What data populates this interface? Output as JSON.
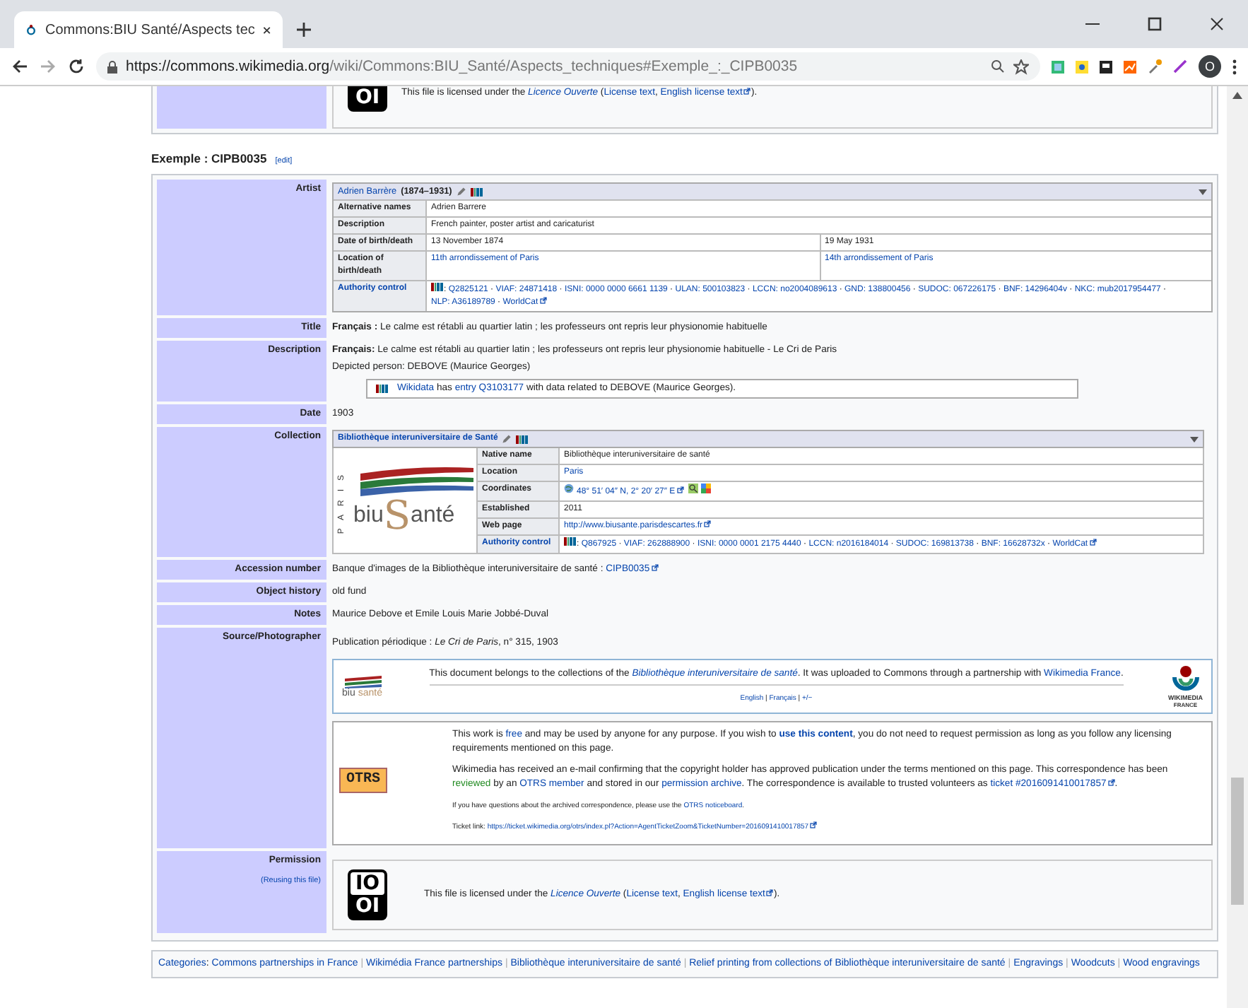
{
  "browser": {
    "tab_title": "Commons:BIU Santé/Aspects tec",
    "url_host": "https://commons.wikimedia.org",
    "url_path": "/wiki/Commons:BIU_Santé/Aspects_techniques#Exemple_:_CIPB0035",
    "profile_initial": "O"
  },
  "previous_permission": {
    "logo": "OI",
    "text": [
      {
        "kind": "plain",
        "text": "This file is licensed under the "
      },
      {
        "kind": "italic-link",
        "text": "Licence Ouverte"
      },
      {
        "kind": "plain",
        "text": " ("
      },
      {
        "kind": "link",
        "text": "License text"
      },
      {
        "kind": "plain",
        "text": ", "
      },
      {
        "kind": "external",
        "text": "English license text"
      },
      {
        "kind": "plain",
        "text": ")."
      }
    ]
  },
  "section": {
    "title": "Exemple : CIPB0035",
    "edit": "[edit]"
  },
  "fields": [
    {
      "kind": "creator",
      "label": "Artist",
      "name": "Adrien Barrère",
      "dates": "(1874–1931)",
      "rows": [
        {
          "kind": "plain",
          "label": "Alternative names",
          "cells": [
            [
              {
                "kind": "plain",
                "text": "Adrien Barrere"
              }
            ]
          ]
        },
        {
          "kind": "plain",
          "label": "Description",
          "cells": [
            [
              {
                "kind": "plain",
                "text": "French painter, poster artist and caricaturist"
              }
            ]
          ]
        },
        {
          "kind": "plain",
          "label": "Date of birth/death",
          "cells": [
            [
              {
                "kind": "plain",
                "text": "13 November 1874"
              }
            ],
            [
              {
                "kind": "plain",
                "text": "19 May 1931"
              }
            ]
          ]
        },
        {
          "kind": "plain",
          "label": "Location of birth/death",
          "cells": [
            [
              {
                "kind": "link",
                "text": "11th arrondissement of Paris"
              }
            ],
            [
              {
                "kind": "link",
                "text": "14th arrondissement of Paris"
              }
            ]
          ]
        },
        {
          "kind": "authority",
          "label": "Authority control",
          "cells": [
            [
              {
                "kind": "plain",
                "text": ": "
              },
              {
                "kind": "link",
                "text": "Q2825121"
              },
              {
                "kind": "plain",
                "text": " · "
              },
              {
                "kind": "link",
                "text": "VIAF: 24871418"
              },
              {
                "kind": "plain",
                "text": " · "
              },
              {
                "kind": "link",
                "text": "ISNI: 0000 0000 6661 1139"
              },
              {
                "kind": "plain",
                "text": " · "
              },
              {
                "kind": "link",
                "text": "ULAN: 500103823"
              },
              {
                "kind": "plain",
                "text": " · "
              },
              {
                "kind": "link",
                "text": "LCCN: no2004089613"
              },
              {
                "kind": "plain",
                "text": " · "
              },
              {
                "kind": "link",
                "text": "GND: 138800456"
              },
              {
                "kind": "plain",
                "text": " · "
              },
              {
                "kind": "link",
                "text": "SUDOC: 067226175"
              },
              {
                "kind": "plain",
                "text": " · "
              },
              {
                "kind": "link",
                "text": "BNF: 14296404v"
              },
              {
                "kind": "plain",
                "text": " · "
              },
              {
                "kind": "link",
                "text": "NKC: mub2017954477"
              },
              {
                "kind": "plain",
                "text": " · "
              },
              {
                "kind": "link",
                "text": "NLP: A36189789"
              },
              {
                "kind": "plain",
                "text": " · "
              },
              {
                "kind": "external",
                "text": "WorldCat"
              }
            ]
          ]
        }
      ]
    },
    {
      "kind": "text",
      "label": "Title",
      "paragraphs": [
        [
          {
            "kind": "bold",
            "text": "Français :"
          },
          {
            "kind": "plain",
            "text": " Le calme est rétabli au quartier latin ; les professeurs ont repris leur physionomie habituelle"
          }
        ]
      ]
    },
    {
      "kind": "text",
      "label": "Description",
      "paragraphs": [
        [
          {
            "kind": "bold",
            "text": "Français:"
          },
          {
            "kind": "plain",
            "text": " Le calme est rétabli au quartier latin ; les professeurs ont repris leur physionomie habituelle - Le Cri de Paris"
          }
        ],
        [
          {
            "kind": "plain",
            "text": "Depicted person: DEBOVE (Maurice Georges)"
          }
        ]
      ],
      "wikidata_note": [
        {
          "kind": "link",
          "text": "Wikidata"
        },
        {
          "kind": "plain",
          "text": " has "
        },
        {
          "kind": "link",
          "text": "entry Q3103177"
        },
        {
          "kind": "plain",
          "text": " with data related to DEBOVE (Maurice Georges)."
        }
      ]
    },
    {
      "kind": "text",
      "label": "Date",
      "paragraphs": [
        [
          {
            "kind": "plain",
            "text": "1903"
          }
        ]
      ]
    },
    {
      "kind": "institution",
      "label": "Collection",
      "name": "Bibliothèque interuniversitaire de Santé",
      "logo": {
        "side": "PARIS",
        "left": "biu",
        "letter": "S",
        "right": "anté"
      },
      "rows": [
        {
          "kind": "plain",
          "label": "Native name",
          "cells": [
            [
              {
                "kind": "plain",
                "text": "Bibliothèque interuniversitaire de santé"
              }
            ]
          ]
        },
        {
          "kind": "plain",
          "label": "Location",
          "cells": [
            [
              {
                "kind": "link",
                "text": "Paris"
              }
            ]
          ]
        },
        {
          "kind": "coordinates",
          "label": "Coordinates",
          "cells": [
            [
              {
                "kind": "external",
                "text": "48° 51′ 04″ N, 2° 20′ 27″ E"
              }
            ]
          ]
        },
        {
          "kind": "plain",
          "label": "Established",
          "cells": [
            [
              {
                "kind": "plain",
                "text": "2011"
              }
            ]
          ]
        },
        {
          "kind": "plain",
          "label": "Web page",
          "cells": [
            [
              {
                "kind": "external",
                "text": "http://www.biusante.parisdescartes.fr"
              }
            ]
          ]
        },
        {
          "kind": "authority",
          "label": "Authority control",
          "cells": [
            [
              {
                "kind": "plain",
                "text": ": "
              },
              {
                "kind": "link",
                "text": "Q867925"
              },
              {
                "kind": "plain",
                "text": " · "
              },
              {
                "kind": "link",
                "text": "VIAF: 262888900"
              },
              {
                "kind": "plain",
                "text": " · "
              },
              {
                "kind": "link",
                "text": "ISNI: 0000 0001 2175 4440"
              },
              {
                "kind": "plain",
                "text": " · "
              },
              {
                "kind": "link",
                "text": "LCCN: n2016184014"
              },
              {
                "kind": "plain",
                "text": " · "
              },
              {
                "kind": "link",
                "text": "SUDOC: 169813738"
              },
              {
                "kind": "plain",
                "text": " · "
              },
              {
                "kind": "link",
                "text": "BNF: 16628732x"
              },
              {
                "kind": "plain",
                "text": " · "
              },
              {
                "kind": "external",
                "text": "WorldCat"
              }
            ]
          ]
        }
      ]
    },
    {
      "kind": "text",
      "label": "Accession number",
      "paragraphs": [
        [
          {
            "kind": "plain",
            "text": "Banque d'images de la Bibliothèque interuniversitaire de santé : "
          },
          {
            "kind": "external",
            "text": "CIPB0035"
          }
        ]
      ]
    },
    {
      "kind": "text",
      "label": "Object history",
      "paragraphs": [
        [
          {
            "kind": "plain",
            "text": "old fund"
          }
        ]
      ]
    },
    {
      "kind": "text",
      "label": "Notes",
      "paragraphs": [
        [
          {
            "kind": "plain",
            "text": "Maurice Debove et Emile Louis Marie Jobbé-Duval"
          }
        ]
      ]
    },
    {
      "kind": "source",
      "label": "Source/Photographer",
      "paragraphs": [
        [
          {
            "kind": "plain",
            "text": "Publication périodique : "
          },
          {
            "kind": "italic",
            "text": "Le Cri de Paris"
          },
          {
            "kind": "plain",
            "text": ", n° 315, 1903"
          }
        ]
      ],
      "partnership": {
        "logo": {
          "left": "biu",
          "right": "santé"
        },
        "text": [
          {
            "kind": "plain",
            "text": "This document belongs to the collections of the "
          },
          {
            "kind": "italic-link",
            "text": "Bibliothèque interuniversitaire de santé"
          },
          {
            "kind": "plain",
            "text": ". It was uploaded to Commons through a partnership with "
          },
          {
            "kind": "link",
            "text": "Wikimedia France"
          },
          {
            "kind": "plain",
            "text": "."
          }
        ],
        "languages": [
          {
            "kind": "link",
            "text": "English"
          },
          {
            "kind": "plain",
            "text": " | "
          },
          {
            "kind": "link",
            "text": "Français"
          },
          {
            "kind": "plain",
            "text": " | "
          },
          {
            "kind": "link",
            "text": "+/−"
          }
        ],
        "partner_logo": [
          "WIKIMEDIA",
          "FRANCE"
        ]
      },
      "otrs": {
        "badge": "OTRS",
        "paragraphs": [
          {
            "kind": "main",
            "segs": [
              {
                "kind": "plain",
                "text": "This work is "
              },
              {
                "kind": "link",
                "text": "free"
              },
              {
                "kind": "plain",
                "text": " and may be used by anyone for any purpose. If you wish to "
              },
              {
                "kind": "bold-link",
                "text": "use this content"
              },
              {
                "kind": "plain",
                "text": ", you do not need to request permission as long as you follow any licensing requirements mentioned on this page."
              }
            ]
          },
          {
            "kind": "main",
            "segs": [
              {
                "kind": "plain",
                "text": "Wikimedia has received an e-mail confirming that the copyright holder has approved publication under the terms mentioned on this page. This correspondence has been "
              },
              {
                "kind": "green-link",
                "text": "reviewed"
              },
              {
                "kind": "plain",
                "text": " by an "
              },
              {
                "kind": "link",
                "text": "OTRS member"
              },
              {
                "kind": "plain",
                "text": " and stored in our "
              },
              {
                "kind": "link",
                "text": "permission archive"
              },
              {
                "kind": "plain",
                "text": ". The correspondence is available to trusted volunteers as "
              },
              {
                "kind": "external",
                "text": "ticket #2016091410017857"
              },
              {
                "kind": "plain",
                "text": "."
              }
            ]
          },
          {
            "kind": "note",
            "segs": [
              {
                "kind": "plain",
                "text": "If you have questions about the archived correspondence, please use the "
              },
              {
                "kind": "link",
                "text": "OTRS noticeboard"
              },
              {
                "kind": "plain",
                "text": "."
              }
            ]
          },
          {
            "kind": "note",
            "segs": [
              {
                "kind": "plain",
                "text": "Ticket link: "
              },
              {
                "kind": "external",
                "text": "https://ticket.wikimedia.org/otrs/index.pl?Action=AgentTicketZoom&TicketNumber=2016091410017857"
              }
            ]
          }
        ]
      }
    },
    {
      "kind": "license",
      "label": "Permission",
      "sublabel": "(Reusing this file)",
      "logo": [
        "IO",
        "OI"
      ],
      "text": [
        {
          "kind": "plain",
          "text": "This file is licensed under the "
        },
        {
          "kind": "italic-link",
          "text": "Licence Ouverte"
        },
        {
          "kind": "plain",
          "text": " ("
        },
        {
          "kind": "link",
          "text": "License text"
        },
        {
          "kind": "plain",
          "text": ", "
        },
        {
          "kind": "external",
          "text": "English license text"
        },
        {
          "kind": "plain",
          "text": ")."
        }
      ]
    }
  ],
  "categories": {
    "label": "Categories",
    "label_suffix": ":",
    "separator": "|",
    "items": [
      "Commons partnerships in France",
      "Wikimédia France partnerships",
      "Bibliothèque interuniversitaire de santé",
      "Relief printing from collections of Bibliothèque interuniversitaire de santé",
      "Engravings",
      "Woodcuts",
      "Wood engravings"
    ]
  }
}
